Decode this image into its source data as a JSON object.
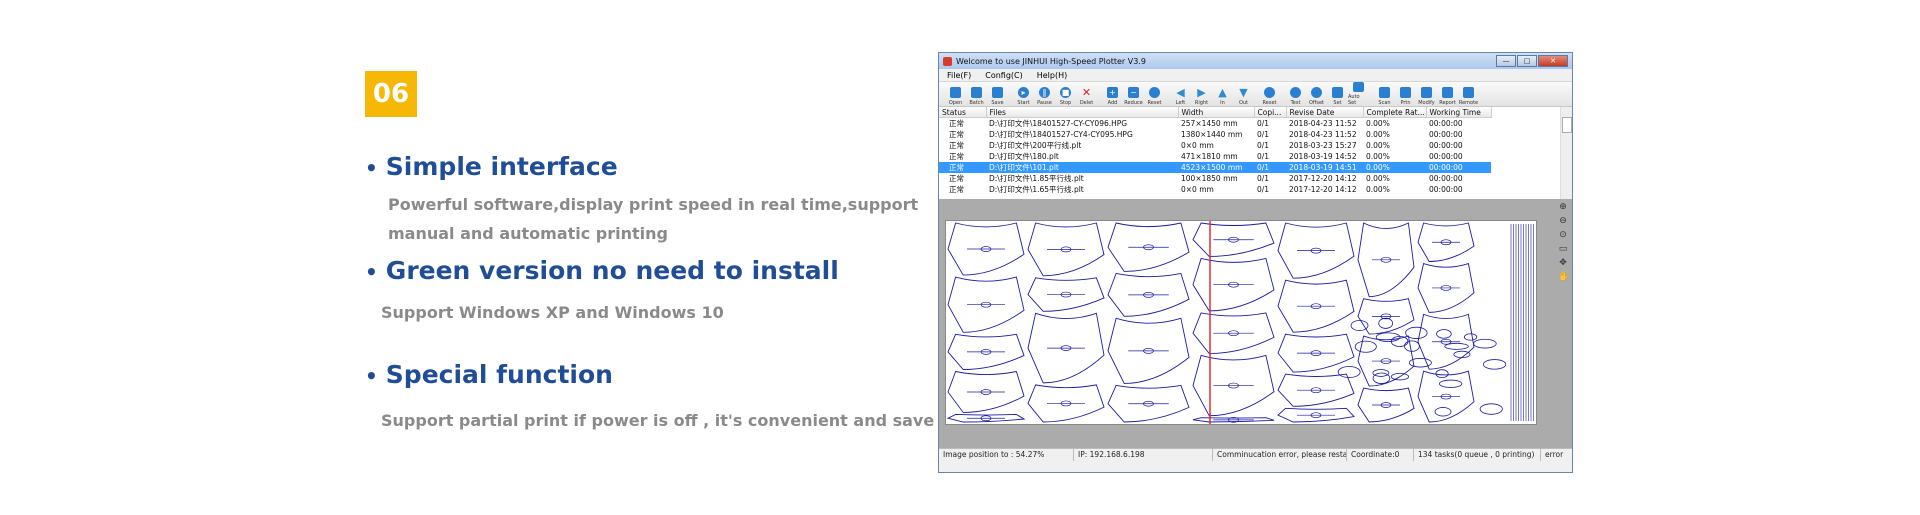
{
  "badge": "06",
  "features": [
    {
      "title": "Simple interface",
      "desc": [
        "Powerful software,display print speed in real time,support",
        "manual and automatic printing"
      ]
    },
    {
      "title": "Green version no need to install",
      "desc": [
        "Support Windows XP and Windows 10"
      ]
    },
    {
      "title": "Special function",
      "desc": [
        "Support partial print if power is off , it's convenient and save cost"
      ]
    }
  ],
  "window": {
    "title": "Welcome to use JINHUI High-Speed Plotter V3.9",
    "controls": {
      "min": "—",
      "max": "□",
      "close": "✕"
    },
    "menu": [
      "File(F)",
      "Config(C)",
      "Help(H)"
    ],
    "toolbar": [
      {
        "label": "Open",
        "icon": "open-icon"
      },
      {
        "label": "Batch",
        "icon": "batch-icon"
      },
      {
        "label": "Save",
        "icon": "save-icon"
      },
      {
        "label": "Start",
        "icon": "start-icon"
      },
      {
        "label": "Pause",
        "icon": "pause-icon"
      },
      {
        "label": "Stop",
        "icon": "stop-icon"
      },
      {
        "label": "Delet",
        "icon": "delete-icon"
      },
      {
        "label": "Add",
        "icon": "add-icon"
      },
      {
        "label": "Reduce",
        "icon": "reduce-icon"
      },
      {
        "label": "Reset",
        "icon": "reset-icon"
      },
      {
        "label": "Left",
        "icon": "left-arrow-icon"
      },
      {
        "label": "Right",
        "icon": "right-arrow-icon"
      },
      {
        "label": "In",
        "icon": "in-arrow-icon"
      },
      {
        "label": "Out",
        "icon": "out-arrow-icon"
      },
      {
        "label": "Reset",
        "icon": "reset-print-icon"
      },
      {
        "label": "Test",
        "icon": "test-icon"
      },
      {
        "label": "Offset",
        "icon": "offset-icon"
      },
      {
        "label": "Set",
        "icon": "set-icon"
      },
      {
        "label": "Auto Set",
        "icon": "auto-set-icon"
      },
      {
        "label": "Scan",
        "icon": "scan-icon"
      },
      {
        "label": "Prtn",
        "icon": "print-icon"
      },
      {
        "label": "Modify",
        "icon": "modify-icon"
      },
      {
        "label": "Report",
        "icon": "report-icon"
      },
      {
        "label": "Remote",
        "icon": "remote-icon"
      }
    ],
    "columns": [
      "Status",
      "Files",
      "Width",
      "Copi...",
      "Revise Date",
      "Complete Rat...",
      "Working Time"
    ],
    "rows": [
      [
        "正常",
        "D:\\打印文件\\18401527-CY-CY096.HPG",
        "257×1450 mm",
        "0/1",
        "2018-04-23 11:52",
        "0.00%",
        "00:00:00"
      ],
      [
        "正常",
        "D:\\打印文件\\18401527-CY4-CY095.HPG",
        "1380×1440 mm",
        "0/1",
        "2018-04-23 11:52",
        "0.00%",
        "00:00:00"
      ],
      [
        "正常",
        "D:\\打印文件\\200平行线.plt",
        "0×0 mm",
        "0/1",
        "2018-03-23 15:27",
        "0.00%",
        "00:00:00"
      ],
      [
        "正常",
        "D:\\打印文件\\180.plt",
        "471×1810 mm",
        "0/1",
        "2018-03-19 14:52",
        "0.00%",
        "00:00:00"
      ],
      [
        "正常",
        "D:\\打印文件\\101.plt",
        "4523×1500 mm",
        "0/1",
        "2018-03-19 14:51",
        "0.00%",
        "00:00:00"
      ],
      [
        "正常",
        "D:\\打印文件\\1.85平行线.plt",
        "100×1850 mm",
        "0/1",
        "2017-12-20 14:12",
        "0.00%",
        "00:00:00"
      ],
      [
        "正常",
        "D:\\打印文件\\1.65平行线.plt",
        "0×0 mm",
        "0/1",
        "2017-12-20 14:12",
        "0.00%",
        "00:00:00"
      ]
    ],
    "selected_row": 4,
    "status": {
      "position": "Image position to : 54.27%",
      "ip": "IP: 192.168.6.198",
      "comm": "Comminucation error, please resta",
      "coord": "Coordinate:0",
      "tasks": "134 tasks(0 queue , 0 printing)",
      "error": "error"
    },
    "side_tools": [
      "zoom-in-icon",
      "zoom-out-icon",
      "zoom-fit-icon",
      "page-icon",
      "move-icon",
      "hand-icon"
    ]
  },
  "colors": {
    "badge": "#f7b707",
    "title": "#1f4e96",
    "desc": "#8a8a8a",
    "selection": "#3399ff",
    "pattern": "#1a1aa8",
    "cutline": "#e0201f"
  }
}
